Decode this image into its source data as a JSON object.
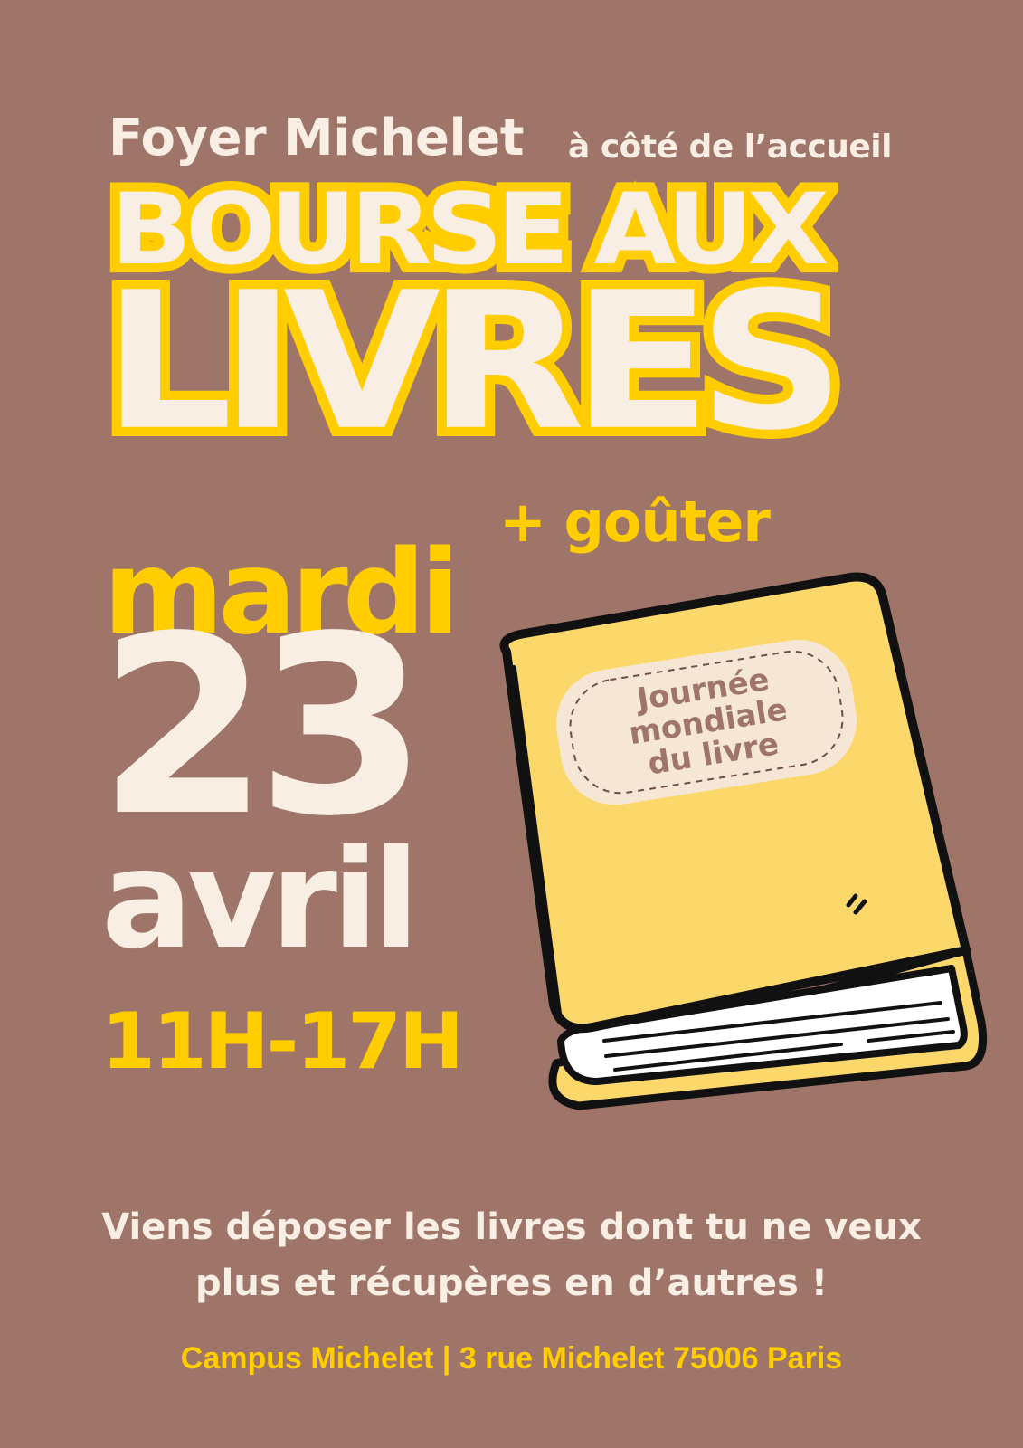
{
  "header": {
    "venue": "Foyer Michelet",
    "venue_detail": "à côté de l’accueil"
  },
  "title": {
    "line1": "BOURSE AUX",
    "line2": "LIVRES",
    "extra": "+ goûter"
  },
  "date": {
    "weekday": "mardi",
    "day": "23",
    "month": "avril",
    "hours": "11H-17H"
  },
  "book_label": {
    "line1": "Journée",
    "line2": "mondiale",
    "line3": "du livre"
  },
  "description": {
    "line1": "Viens déposer les livres dont tu ne veux",
    "line2": "plus et récupères en d’autres !"
  },
  "footer": {
    "address": "Campus Michelet | 3 rue Michelet 75006 Paris"
  },
  "colors": {
    "background": "#9e7568",
    "accent_yellow": "#ffcd00",
    "cream": "#f8eee4",
    "book_yellow": "#fcd86a"
  },
  "illustration": "book-icon"
}
